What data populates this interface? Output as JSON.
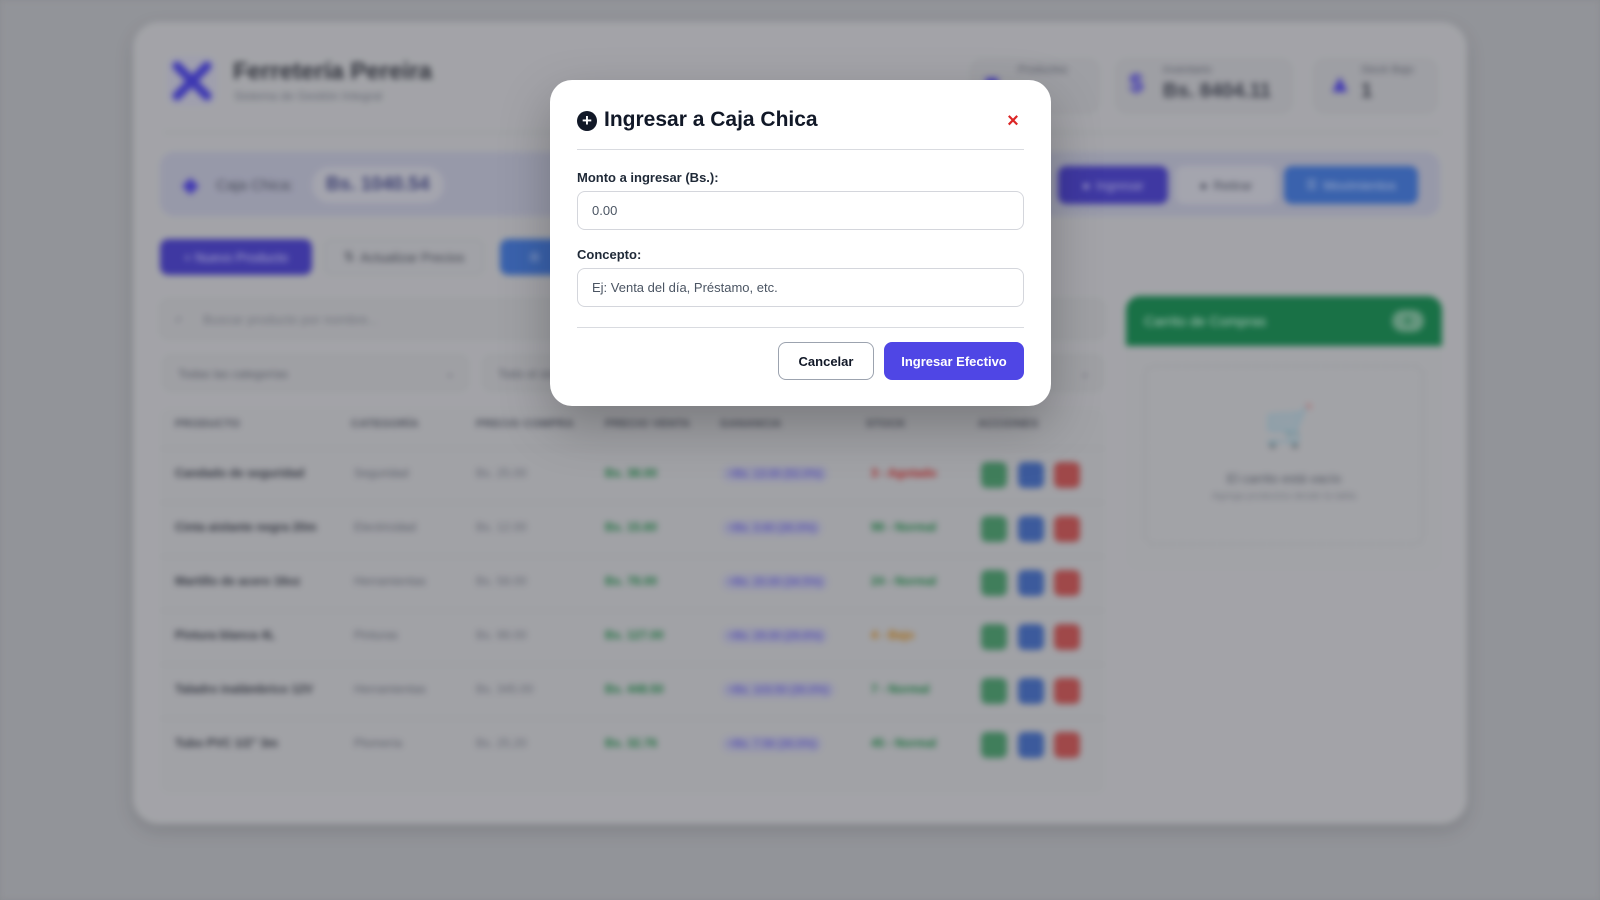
{
  "app": {
    "brand_title": "Ferretería Pereira",
    "brand_subtitle": "Sistema de Gestión Integral",
    "stats": [
      {
        "label": "Productos",
        "value": "",
        "icon": "box-icon"
      },
      {
        "label": "Inventario",
        "value": "Bs. 8404.11",
        "icon": "dollar-icon"
      },
      {
        "label": "Stock Bajo",
        "value": "1",
        "icon": "warning-icon"
      }
    ],
    "caja": {
      "label": "Caja Chica:",
      "amount": "Bs. 1040.54",
      "ingresar_label": "Ingresar",
      "retirar_label": "Retirar",
      "movimientos_label": "Movimientos"
    },
    "actions": {
      "nuevo_label": "+ Nuevo Producto",
      "actualizar_label": "Actualizar Precios",
      "third_label": "R"
    },
    "search_placeholder": "Buscar producto por nombre...",
    "filters": {
      "category": "Todas las categorías",
      "second": "Todo el stock"
    },
    "table": {
      "headers": [
        "PRODUCTO",
        "CATEGORÍA",
        "PRECIO COMPRA",
        "PRECIO VENTA",
        "GANANCIA",
        "STOCK",
        "ACCIONES"
      ],
      "rows": [
        {
          "name": "Candado de seguridad",
          "category": "Seguridad",
          "buy": "Bs. 25.00",
          "sell": "Bs. 38.00",
          "gain": "+Bs. 13.00 (52.0%)",
          "stock": "3 - Agotado",
          "stock_color": "#b91c1c"
        },
        {
          "name": "Cinta aislante negra 20m",
          "category": "Electricidad",
          "buy": "Bs. 12.00",
          "sell": "Bs. 15.60",
          "gain": "+Bs. 3.60 (30.0%)",
          "stock": "98 - Normal",
          "stock_color": "#157a3c"
        },
        {
          "name": "Martillo de acero 16oz",
          "category": "Herramientas",
          "buy": "Bs. 58.00",
          "sell": "Bs. 78.00",
          "gain": "+Bs. 20.00 (34.5%)",
          "stock": "24 - Normal",
          "stock_color": "#157a3c"
        },
        {
          "name": "Pintura blanca 4L",
          "category": "Pinturas",
          "buy": "Bs. 98.00",
          "sell": "Bs. 127.00",
          "gain": "+Bs. 29.00 (29.6%)",
          "stock": "4 - Bajo",
          "stock_color": "#b97309"
        },
        {
          "name": "Taladro inalámbrico 12V",
          "category": "Herramientas",
          "buy": "Bs. 345.00",
          "sell": "Bs. 448.50",
          "gain": "+Bs. 103.50 (30.0%)",
          "stock": "7 - Normal",
          "stock_color": "#157a3c"
        },
        {
          "name": "Tubo PVC 1/2\" 3m",
          "category": "Plomería",
          "buy": "Bs. 25.20",
          "sell": "Bs. 32.76",
          "gain": "+Bs. 7.56 (30.0%)",
          "stock": "45 - Normal",
          "stock_color": "#157a3c"
        }
      ]
    },
    "cart": {
      "title": "Carrito de Compras",
      "count": "0",
      "empty_title": "El carrito está vacío",
      "empty_hint": "Agrega productos desde la tabla"
    }
  },
  "modal": {
    "title": "Ingresar a Caja Chica",
    "close_label": "×",
    "amount_label": "Monto a ingresar (Bs.):",
    "amount_placeholder": "0.00",
    "concept_label": "Concepto:",
    "concept_placeholder": "Ej: Venta del día, Préstamo, etc.",
    "cancel_label": "Cancelar",
    "submit_label": "Ingresar Efectivo"
  },
  "colors": {
    "accent": "#4f46e5",
    "danger": "#dc2626",
    "cart_green": "#0f7a45"
  }
}
